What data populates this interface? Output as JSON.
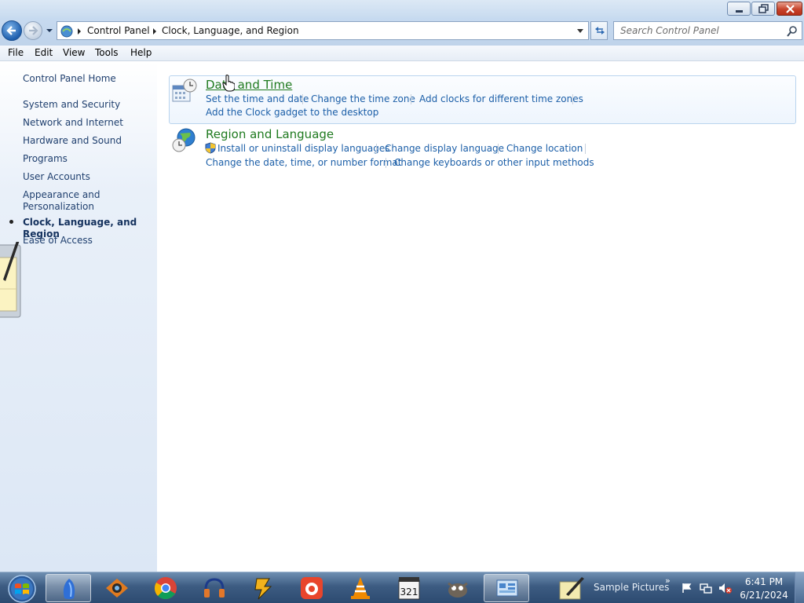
{
  "window": {
    "buttons": [
      "minimize",
      "maximize",
      "close"
    ]
  },
  "address": {
    "breadcrumb": [
      "Control Panel",
      "Clock, Language, and Region"
    ]
  },
  "search": {
    "placeholder": "Search Control Panel"
  },
  "menu": [
    "File",
    "Edit",
    "View",
    "Tools",
    "Help"
  ],
  "sidebar": {
    "home": "Control Panel Home",
    "items": [
      "System and Security",
      "Network and Internet",
      "Hardware and Sound",
      "Programs",
      "User Accounts",
      "Appearance and Personalization",
      "Clock, Language, and Region",
      "Ease of Access"
    ],
    "current": "Clock, Language, and Region"
  },
  "categories": [
    {
      "title": "Date and Time",
      "icon": "calendar-clock-icon",
      "tasks": [
        "Set the time and date",
        "Change the time zone",
        "Add clocks for different time zones",
        "Add the Clock gadget to the desktop"
      ]
    },
    {
      "title": "Region and Language",
      "icon": "globe-clock-icon",
      "tasks": [
        "Install or uninstall display languages",
        "Change display language",
        "Change location",
        "Change the date, time, or number format",
        "Change keyboards or other input methods"
      ]
    }
  ],
  "taskbar": {
    "icons": [
      "ie-icon",
      "eye-app-icon",
      "chrome-icon",
      "audacity-icon",
      "winamp-icon",
      "record-app-icon",
      "vlc-icon",
      "mpc-icon",
      "gimp-icon",
      "control-panel-icon"
    ],
    "toolbar_label": "Sample Pictures",
    "chevron": "»",
    "clock_time": "6:41 PM",
    "clock_date": "6/21/2024"
  },
  "colors": {
    "link": "#1c5fa8",
    "category_title": "#1f7a1f",
    "sidebar_text": "#1f3f6e"
  }
}
